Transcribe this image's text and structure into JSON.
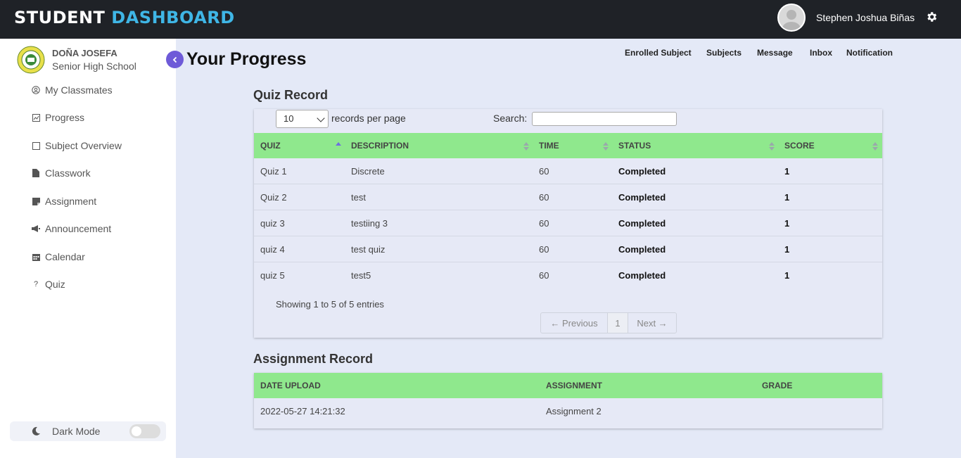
{
  "header": {
    "brand_part1": "STUDENT",
    "brand_part2": "DASHBOARD",
    "username": "Stephen Joshua Biñas",
    "icons": [
      "user-avatar",
      "gear-icon"
    ]
  },
  "sidebar": {
    "school_name": "DOÑA JOSEFA",
    "school_sub": "Senior High School",
    "items": [
      {
        "label": "My Classmates",
        "icon": "user-circle-icon"
      },
      {
        "label": "Progress",
        "icon": "chart-icon"
      },
      {
        "label": "Subject Overview",
        "icon": "square-icon"
      },
      {
        "label": "Classwork",
        "icon": "file-icon"
      },
      {
        "label": "Assignment",
        "icon": "note-icon"
      },
      {
        "label": "Announcement",
        "icon": "megaphone-icon"
      },
      {
        "label": "Calendar",
        "icon": "calendar-icon"
      },
      {
        "label": "Quiz",
        "icon": "question-icon"
      }
    ],
    "dark_mode_label": "Dark Mode",
    "dark_mode_on": false
  },
  "page": {
    "title": "Your Progress",
    "topnav": [
      "Enrolled Subject",
      "Subjects",
      "Message",
      "Inbox",
      "Notification"
    ]
  },
  "quiz": {
    "title": "Quiz Record",
    "records_per_page": "10",
    "records_per_page_label": "records per page",
    "search_label": "Search:",
    "search_value": "",
    "columns": [
      "QUIZ",
      "DESCRIPTION",
      "TIME",
      "STATUS",
      "SCORE"
    ],
    "rows": [
      [
        "Quiz 1",
        "Discrete",
        "60",
        "Completed",
        "1"
      ],
      [
        "Quiz 2",
        "test",
        "60",
        "Completed",
        "1"
      ],
      [
        "quiz 3",
        "testiing 3",
        "60",
        "Completed",
        "1"
      ],
      [
        "quiz 4",
        "test quiz",
        "60",
        "Completed",
        "1"
      ],
      [
        "quiz 5",
        "test5",
        "60",
        "Completed",
        "1"
      ]
    ],
    "showing": "Showing 1 to 5 of 5 entries",
    "pager": {
      "previous": "← Previous",
      "page": "1",
      "next": "Next →"
    }
  },
  "assignment": {
    "title": "Assignment Record",
    "columns": [
      "DATE UPLOAD",
      "ASSIGNMENT",
      "GRADE"
    ],
    "rows": [
      [
        "2022-05-27 14:21:32",
        "Assignment 2",
        ""
      ]
    ]
  },
  "colors": {
    "topbar": "#1f2227",
    "brand_accent": "#3fb6e6",
    "table_header": "#8fe88d",
    "collapse_button": "#6e5ad8",
    "content_bg": "#e4e9f7"
  }
}
